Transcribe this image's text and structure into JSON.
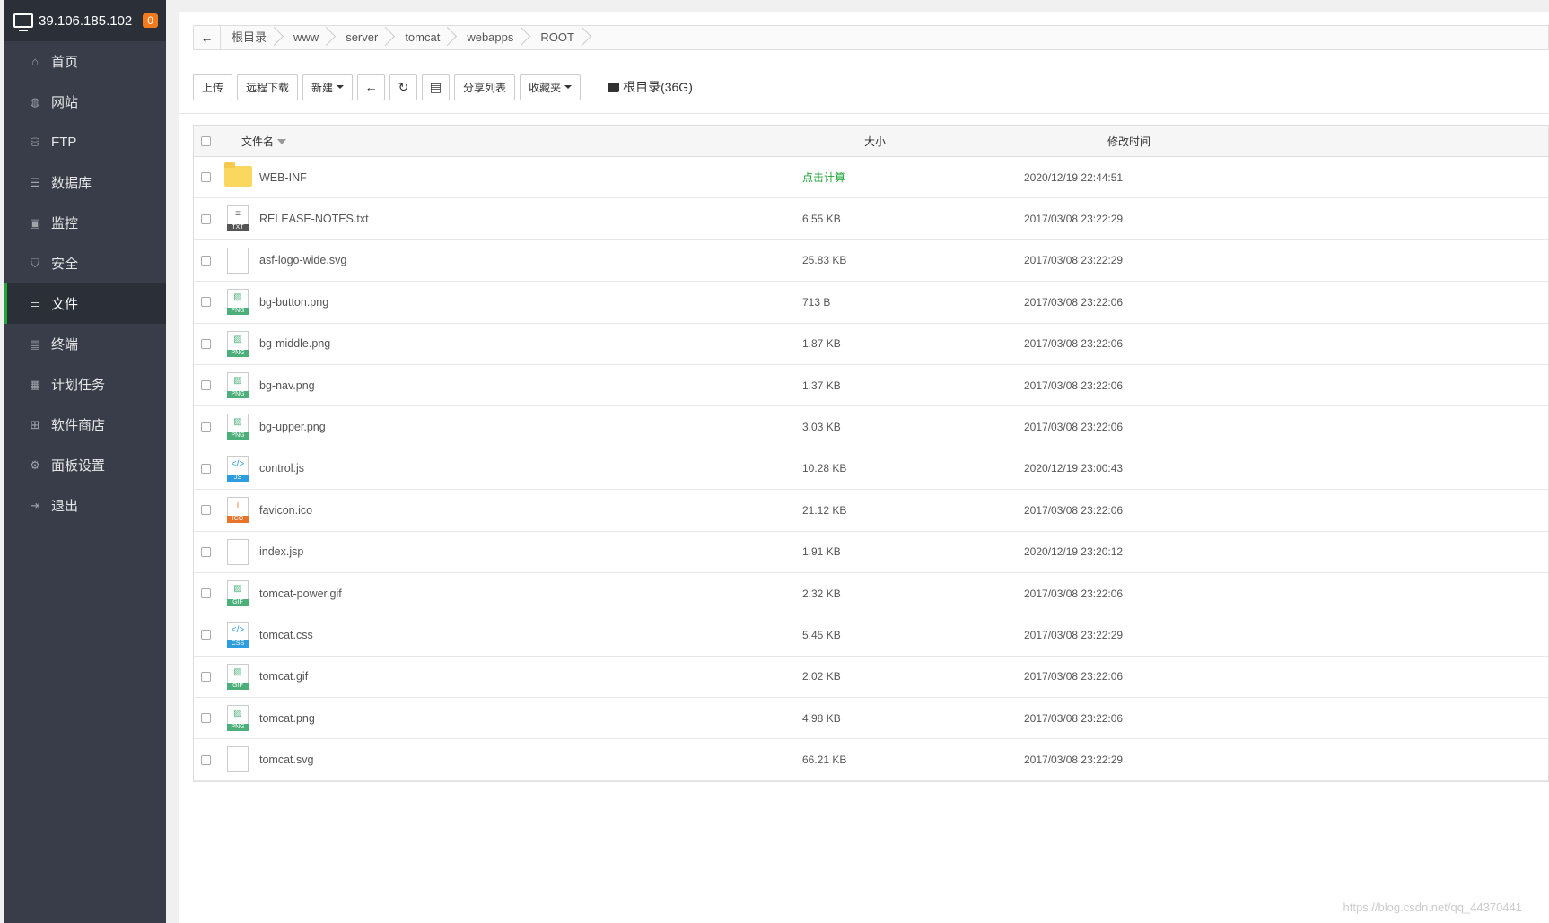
{
  "header": {
    "ip": "39.106.185.102",
    "badge": "0"
  },
  "nav": [
    {
      "label": "首页",
      "icon": "home-icon",
      "glyph": "⌂"
    },
    {
      "label": "网站",
      "icon": "globe-icon",
      "glyph": "◍"
    },
    {
      "label": "FTP",
      "icon": "ftp-icon",
      "glyph": "⛁"
    },
    {
      "label": "数据库",
      "icon": "database-icon",
      "glyph": "☰"
    },
    {
      "label": "监控",
      "icon": "monitor-icon",
      "glyph": "▣"
    },
    {
      "label": "安全",
      "icon": "shield-icon",
      "glyph": "⛉"
    },
    {
      "label": "文件",
      "icon": "folder-icon",
      "glyph": "▭"
    },
    {
      "label": "终端",
      "icon": "terminal-icon",
      "glyph": "▤"
    },
    {
      "label": "计划任务",
      "icon": "calendar-icon",
      "glyph": "▦"
    },
    {
      "label": "软件商店",
      "icon": "apps-icon",
      "glyph": "⊞"
    },
    {
      "label": "面板设置",
      "icon": "gear-icon",
      "glyph": "⚙"
    },
    {
      "label": "退出",
      "icon": "logout-icon",
      "glyph": "⇥"
    }
  ],
  "breadcrumb": [
    "根目录",
    "www",
    "server",
    "tomcat",
    "webapps",
    "ROOT"
  ],
  "toolbar": {
    "upload": "上传",
    "remote_download": "远程下载",
    "new": "新建",
    "share_list": "分享列表",
    "favorites": "收藏夹",
    "disk": "根目录(36G)"
  },
  "table": {
    "col_name": "文件名",
    "col_size": "大小",
    "col_time": "修改时间",
    "rows": [
      {
        "name": "WEB-INF",
        "size": "点击计算",
        "time": "2020/12/19 22:44:51",
        "type": "folder"
      },
      {
        "name": "RELEASE-NOTES.txt",
        "size": "6.55 KB",
        "time": "2017/03/08 23:22:29",
        "type": "TXT"
      },
      {
        "name": "asf-logo-wide.svg",
        "size": "25.83 KB",
        "time": "2017/03/08 23:22:29",
        "type": "blank"
      },
      {
        "name": "bg-button.png",
        "size": "713 B",
        "time": "2017/03/08 23:22:06",
        "type": "PNG"
      },
      {
        "name": "bg-middle.png",
        "size": "1.87 KB",
        "time": "2017/03/08 23:22:06",
        "type": "PNG"
      },
      {
        "name": "bg-nav.png",
        "size": "1.37 KB",
        "time": "2017/03/08 23:22:06",
        "type": "PNG"
      },
      {
        "name": "bg-upper.png",
        "size": "3.03 KB",
        "time": "2017/03/08 23:22:06",
        "type": "PNG"
      },
      {
        "name": "control.js",
        "size": "10.28 KB",
        "time": "2020/12/19 23:00:43",
        "type": "JS"
      },
      {
        "name": "favicon.ico",
        "size": "21.12 KB",
        "time": "2017/03/08 23:22:06",
        "type": "ICO"
      },
      {
        "name": "index.jsp",
        "size": "1.91 KB",
        "time": "2020/12/19 23:20:12",
        "type": "blank"
      },
      {
        "name": "tomcat-power.gif",
        "size": "2.32 KB",
        "time": "2017/03/08 23:22:06",
        "type": "GIF"
      },
      {
        "name": "tomcat.css",
        "size": "5.45 KB",
        "time": "2017/03/08 23:22:29",
        "type": "CSS"
      },
      {
        "name": "tomcat.gif",
        "size": "2.02 KB",
        "time": "2017/03/08 23:22:06",
        "type": "GIF"
      },
      {
        "name": "tomcat.png",
        "size": "4.98 KB",
        "time": "2017/03/08 23:22:06",
        "type": "PNG"
      },
      {
        "name": "tomcat.svg",
        "size": "66.21 KB",
        "time": "2017/03/08 23:22:29",
        "type": "blank"
      }
    ]
  },
  "watermark": "https://blog.csdn.net/qq_44370441",
  "colors": {
    "sidebar": "#393d49",
    "accent": "#20a53a",
    "badge": "#f37b1d",
    "folder": "#fad860"
  }
}
